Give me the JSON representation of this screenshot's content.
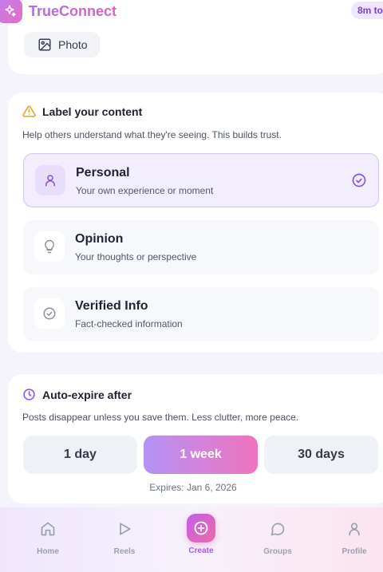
{
  "header": {
    "app_name": "TrueConnect",
    "timer": "8m to",
    "logo_icon": "sparkles-icon"
  },
  "media": {
    "photo_label": "Photo"
  },
  "label_section": {
    "title": "Label your content",
    "subtitle": "Help others understand what they're seeing. This builds trust.",
    "options": [
      {
        "title": "Personal",
        "desc": "Your own experience or moment",
        "icon": "user-icon",
        "selected": true
      },
      {
        "title": "Opinion",
        "desc": "Your thoughts or perspective",
        "icon": "lightbulb-icon",
        "selected": false
      },
      {
        "title": "Verified Info",
        "desc": "Fact-checked information",
        "icon": "check-circle-icon",
        "selected": false
      }
    ]
  },
  "expire_section": {
    "title": "Auto-expire after",
    "subtitle": "Posts disappear unless you save them. Less clutter, more peace.",
    "durations": [
      "1 day",
      "1 week",
      "30 days"
    ],
    "selected": "1 week",
    "expires_text": "Expires: Jan 6, 2026"
  },
  "nav": {
    "items": [
      {
        "label": "Home",
        "icon": "home-icon"
      },
      {
        "label": "Reels",
        "icon": "play-icon"
      },
      {
        "label": "Create",
        "icon": "plus-circle-icon"
      },
      {
        "label": "Groups",
        "icon": "chat-bubble-icon"
      },
      {
        "label": "Profile",
        "icon": "user-icon"
      }
    ],
    "active": "Create"
  },
  "colors": {
    "accent": "#a66ff0",
    "accent_pink": "#e05fb8",
    "warning": "#e8a219"
  }
}
